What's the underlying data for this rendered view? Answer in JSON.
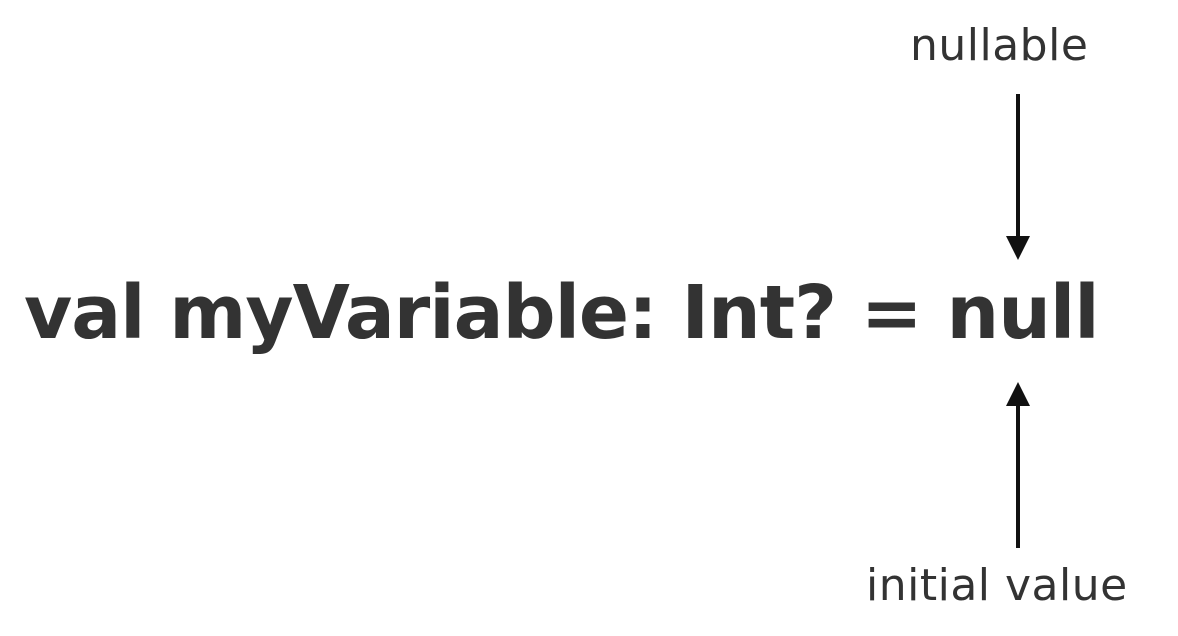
{
  "code": {
    "text": "val myVariable: Int? = null"
  },
  "annotations": {
    "top": "nullable",
    "bottom": "initial value"
  },
  "colors": {
    "text": "#333333",
    "arrow": "#111111",
    "background": "#ffffff"
  }
}
